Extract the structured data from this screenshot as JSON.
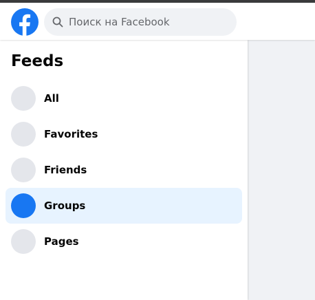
{
  "header": {
    "logo_icon": "facebook-logo-icon",
    "search": {
      "placeholder": "Поиск на Facebook",
      "value": "",
      "icon": "search-icon"
    }
  },
  "sidebar": {
    "title": "Feeds",
    "items": [
      {
        "label": "All",
        "active": false
      },
      {
        "label": "Favorites",
        "active": false
      },
      {
        "label": "Friends",
        "active": false
      },
      {
        "label": "Groups",
        "active": true
      },
      {
        "label": "Pages",
        "active": false
      }
    ]
  },
  "colors": {
    "brand": "#1877f2",
    "active_bg": "#e7f3ff",
    "icon_placeholder": "#e4e6eb",
    "page_bg": "#f0f2f5",
    "text": "#050505",
    "muted_text": "#65676b"
  }
}
